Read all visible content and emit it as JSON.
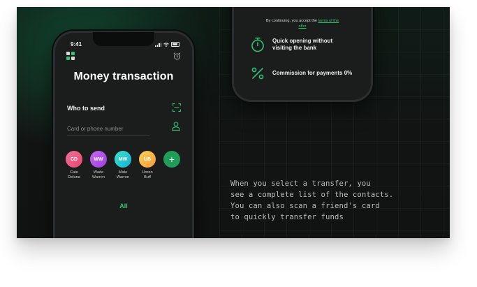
{
  "colors": {
    "accent": "#1f9e5a",
    "accent_text": "#2fc476",
    "background": "#121414",
    "phone_body": "#1b1c1c"
  },
  "top_phone": {
    "terms_prefix": "By continuing, you accept the ",
    "terms_link_part1": "terms of the",
    "terms_link_part2": "offer",
    "features": [
      {
        "icon": "stopwatch-icon",
        "text_line1": "Quick opening without",
        "text_line2": "visiting the bank"
      },
      {
        "icon": "percent-icon",
        "text_line1": "Commission for payments 0%",
        "text_line2": ""
      }
    ]
  },
  "main_phone": {
    "status": {
      "time": "9:41"
    },
    "title": "Money transaction",
    "who_to_send": "Who to send",
    "input_placeholder": "Card or phone number",
    "contacts": [
      {
        "initials": "CD",
        "first": "Cate",
        "last": "Deluna",
        "color_from": "#f0709b",
        "color_to": "#e9486d"
      },
      {
        "initials": "WW",
        "first": "Wade",
        "last": "Warren",
        "color_from": "#c86af2",
        "color_to": "#9d3ce0"
      },
      {
        "initials": "MW",
        "first": "Mate",
        "last": "Warren",
        "color_from": "#3ee3c8",
        "color_to": "#12b1d6"
      },
      {
        "initials": "UB",
        "first": "Uoren",
        "last": "Buff",
        "color_from": "#ffd15a",
        "color_to": "#f39a3a"
      }
    ],
    "add_label": "+",
    "all_label": "All"
  },
  "caption_lines": [
    "When you select a transfer, you",
    "see a complete list of the contacts.",
    "You can also scan a friend's card",
    "to quickly transfer funds"
  ]
}
